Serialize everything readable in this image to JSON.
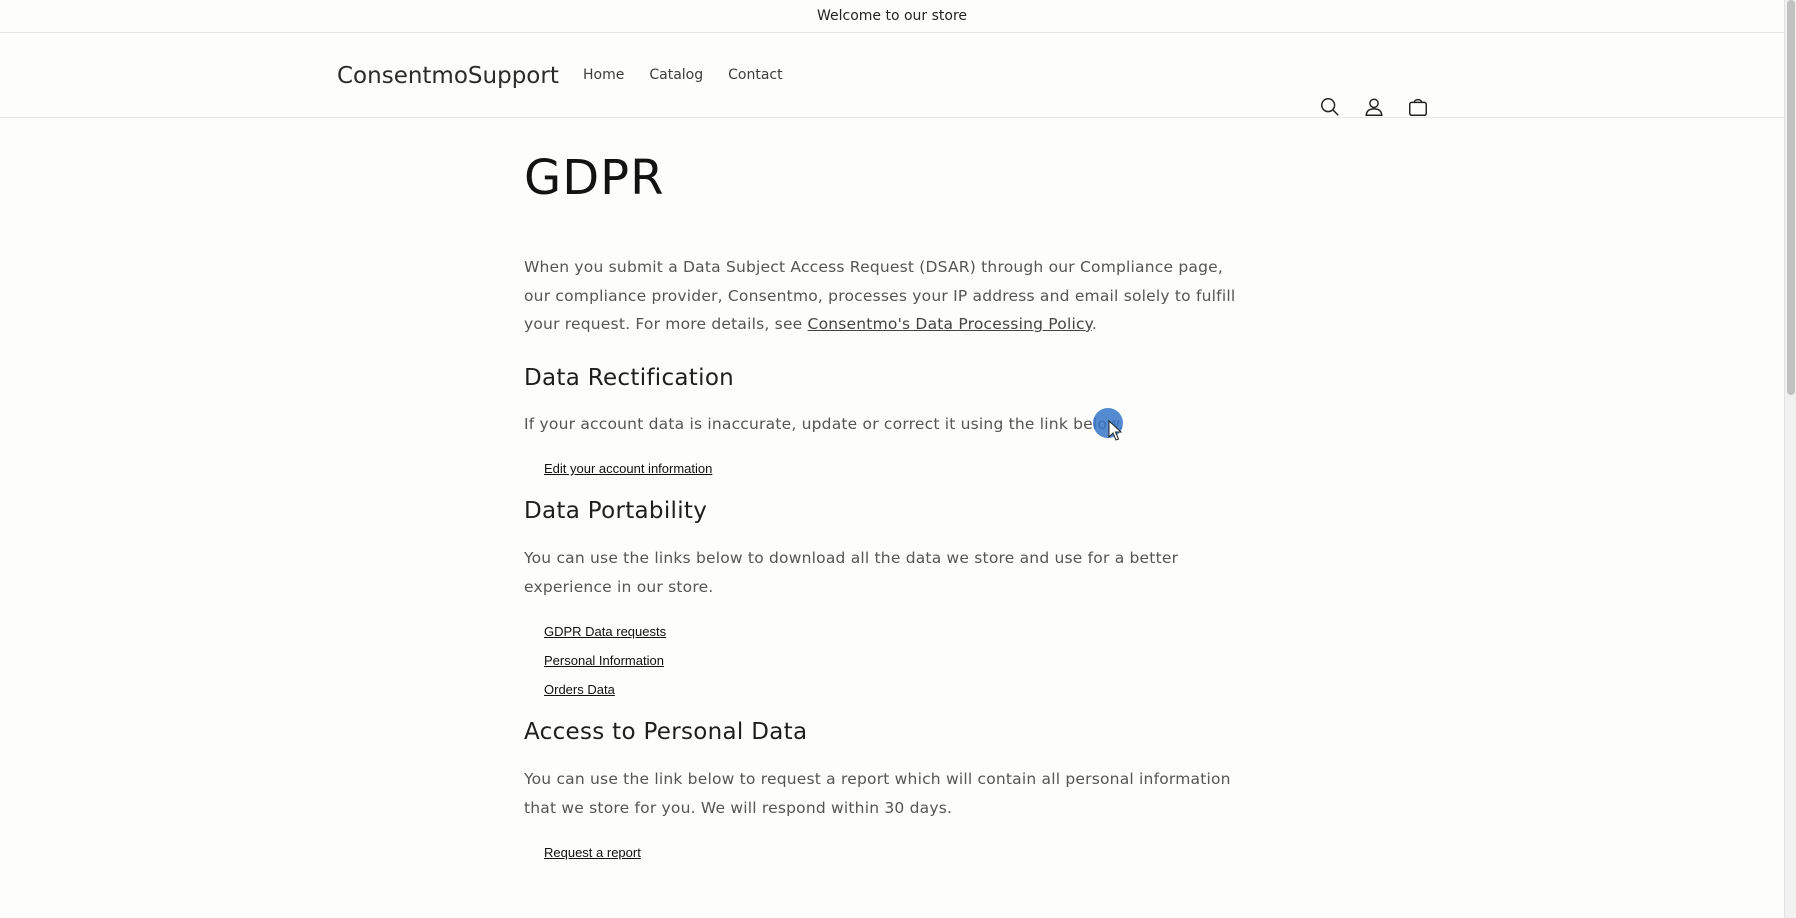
{
  "announcement": {
    "text": "Welcome to our store"
  },
  "header": {
    "logo": "ConsentmoSupport",
    "nav": [
      {
        "label": "Home"
      },
      {
        "label": "Catalog"
      },
      {
        "label": "Contact"
      }
    ],
    "icons": [
      "search-icon",
      "account-icon",
      "cart-icon"
    ]
  },
  "page": {
    "title": "GDPR",
    "intro_before": "When you submit a Data Subject Access Request (DSAR) through our Compliance page, our compliance provider, Consentmo, processes your IP address and email solely to fulfill your request. For more details, see ",
    "intro_link": "Consentmo's Data Processing Policy",
    "intro_after": ".",
    "sections": [
      {
        "title": "Data Rectification",
        "text": "If your account data is inaccurate, update or correct it using the link below.",
        "links": [
          "Edit your account information"
        ]
      },
      {
        "title": "Data Portability",
        "text": "You can use the links below to download all the data we store and use for a better experience in our store.",
        "links": [
          "GDPR Data requests",
          "Personal Information",
          "Orders Data"
        ]
      },
      {
        "title": "Access to Personal Data",
        "text": "You can use the link below to request a report which will contain all personal information that we store for you. We will respond within 30 days.",
        "links": [
          "Request a report"
        ]
      }
    ]
  },
  "colors": {
    "background": "#fdfdfc",
    "text": "#121212",
    "muted_text": "#555555",
    "cursor": "#3575c8"
  }
}
